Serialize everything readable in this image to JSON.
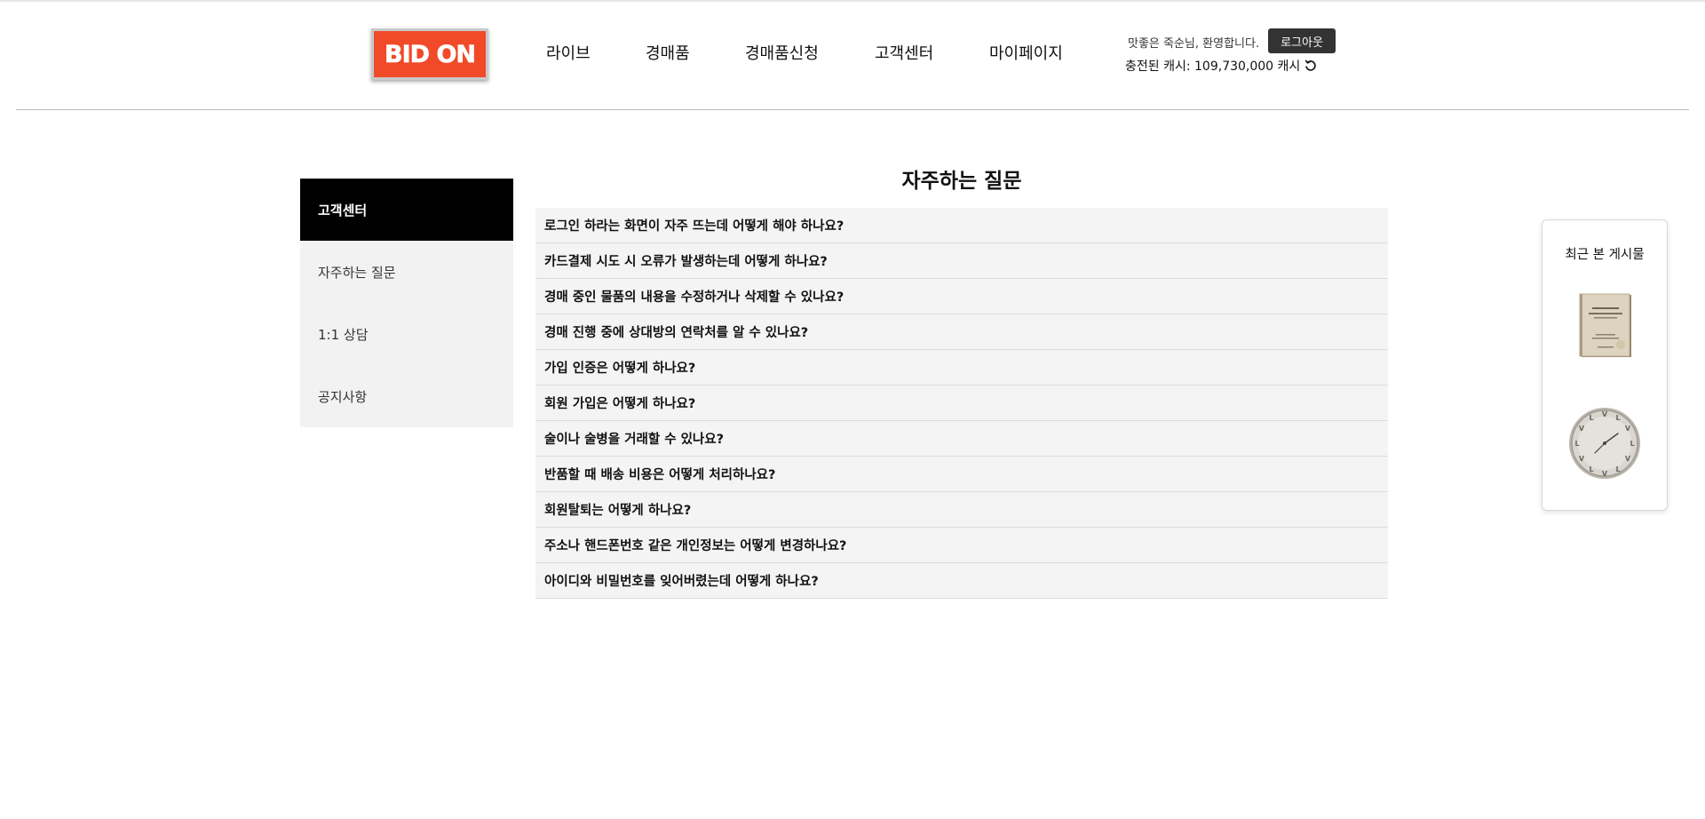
{
  "header": {
    "logo_text": "BID ON",
    "nav": [
      "라이브",
      "경매품",
      "경매품신청",
      "고객센터",
      "마이페이지"
    ],
    "welcome": "맛좋은 죽순님, 환영합니다.",
    "logout_label": "로그아웃",
    "cash_text": "충전된 캐시: 109,730,000 캐시",
    "refresh_icon": "refresh-icon",
    "brand_color": "#f04a28"
  },
  "sidebar": {
    "title": "고객센터",
    "items": [
      "자주하는 질문",
      "1:1 상담",
      "공지사항"
    ]
  },
  "faq": {
    "title": "자주하는 질문",
    "questions": [
      "로그인 하라는 화면이 자주 뜨는데 어떻게 해야 하나요?",
      "카드결제 시도 시 오류가 발생하는데 어떻게 하나요?",
      "경매 중인 물품의 내용을 수정하거나 삭제할 수 있나요?",
      "경매 진행 중에 상대방의 연락처를 알 수 있나요?",
      "가입 인증은 어떻게 하나요?",
      "회원 가입은 어떻게 하나요?",
      "술이나 술병을 거래할 수 있나요?",
      "반품할 때 배송 비용은 어떻게 처리하나요?",
      "회원탈퇴는 어떻게 하나요?",
      "주소나 핸드폰번호 같은 개인정보는 어떻게 변경하나요?",
      "아이디와 비밀번호를 잊어버렸는데 어떻게 하나요?"
    ]
  },
  "recent": {
    "title": "최근 본 게시물",
    "items": [
      "book-thumbnail",
      "clock-thumbnail"
    ]
  }
}
